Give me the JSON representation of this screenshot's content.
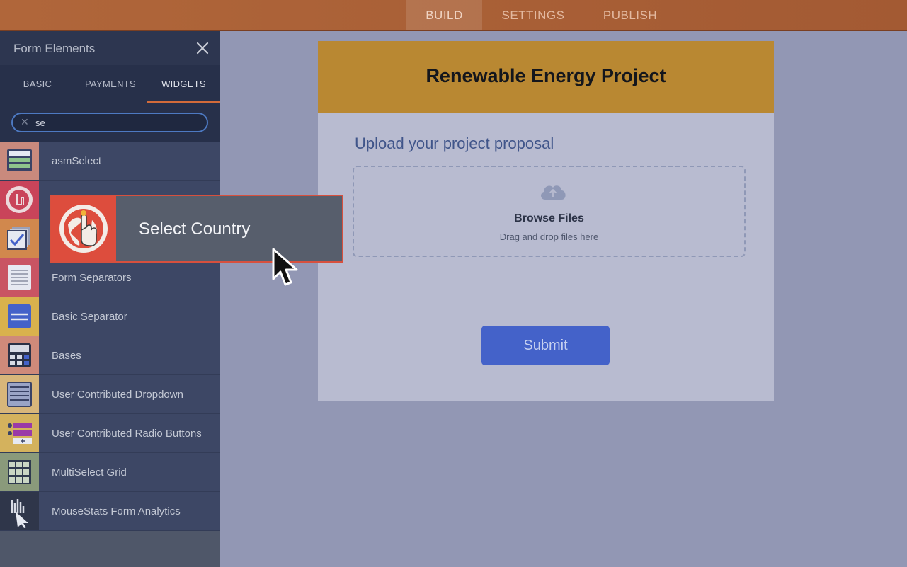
{
  "topbar": {
    "tabs": [
      {
        "label": "BUILD",
        "active": true
      },
      {
        "label": "SETTINGS",
        "active": false
      },
      {
        "label": "PUBLISH",
        "active": false
      }
    ]
  },
  "sidebar": {
    "title": "Form Elements",
    "tabs": [
      {
        "label": "BASIC"
      },
      {
        "label": "PAYMENTS"
      },
      {
        "label": "WIDGETS",
        "active": true
      }
    ],
    "search": {
      "value": "se"
    },
    "items": [
      {
        "label": "asmSelect",
        "icon": "select-list-icon",
        "color": "#c98a7d"
      },
      {
        "label": "",
        "icon": "globe-hand-icon",
        "color": "#c9445a"
      },
      {
        "label": "",
        "icon": "checkbox-stack-icon",
        "color": "#d1884d"
      },
      {
        "label": "Form Separators",
        "icon": "document-lines-icon",
        "color": "#c95463"
      },
      {
        "label": "Basic Separator",
        "icon": "separator-icon",
        "color": "#d9b24d"
      },
      {
        "label": "Bases",
        "icon": "calculator-icon",
        "color": "#cf8a7a"
      },
      {
        "label": "User Contributed Dropdown",
        "icon": "dropdown-icon",
        "color": "#d8b67a"
      },
      {
        "label": "User Contributed Radio Buttons",
        "icon": "radio-buttons-icon",
        "color": "#d4b25d"
      },
      {
        "label": "MultiSelect Grid",
        "icon": "grid-icon",
        "color": "#8a9a7b"
      },
      {
        "label": "MouseStats Form Analytics",
        "icon": "mouse-analytics-icon",
        "color": "#2f364a"
      }
    ]
  },
  "drag": {
    "label": "Select Country",
    "icon": "globe-hand-icon"
  },
  "form": {
    "title": "Renewable Energy Project",
    "upload_label": "Upload your project proposal",
    "dropzone_title": "Browse Files",
    "dropzone_sub": "Drag and drop files here",
    "submit_label": "Submit"
  },
  "colors": {
    "accent": "#d36b3a",
    "header": "#b98832",
    "submit": "#4462c9"
  }
}
